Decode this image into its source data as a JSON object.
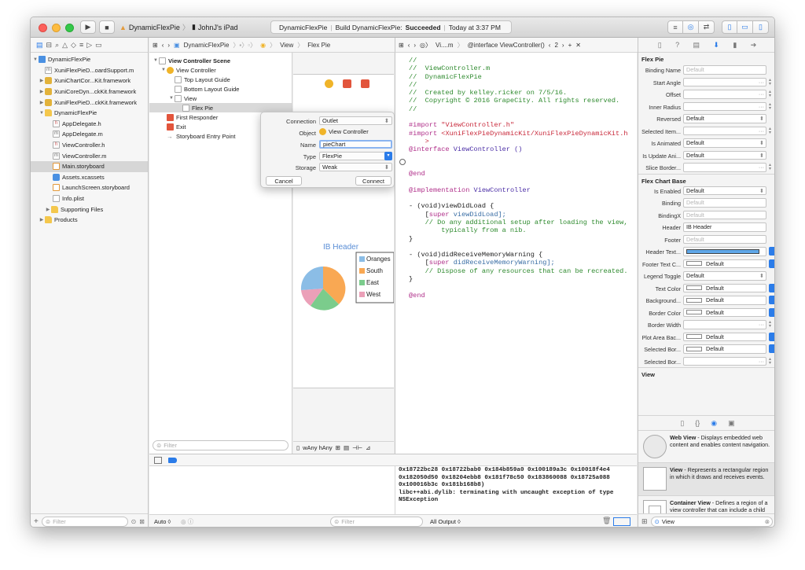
{
  "toolbar": {
    "scheme": "DynamicFlexPie",
    "device": "JohnJ's iPad",
    "activity_project": "DynamicFlexPie",
    "activity_build_prefix": "Build DynamicFlexPie:",
    "activity_build_status": "Succeeded",
    "activity_time": "Today at 3:37 PM"
  },
  "navigator": {
    "items": [
      {
        "label": "DynamicFlexPie"
      },
      {
        "label": "XuniFlexPieD...oardSupport.m"
      },
      {
        "label": "XuniChartCor...Kit.framework"
      },
      {
        "label": "XuniCoreDyn...ckKit.framework"
      },
      {
        "label": "XuniFlexPieD...ckKit.framework"
      },
      {
        "label": "DynamicFlexPie"
      },
      {
        "label": "AppDelegate.h"
      },
      {
        "label": "AppDelegate.m"
      },
      {
        "label": "ViewController.h"
      },
      {
        "label": "ViewController.m"
      },
      {
        "label": "Main.storyboard"
      },
      {
        "label": "Assets.xcassets"
      },
      {
        "label": "LaunchScreen.storyboard"
      },
      {
        "label": "Info.plist"
      },
      {
        "label": "Supporting Files"
      },
      {
        "label": "Products"
      }
    ],
    "filter_placeholder": "Filter"
  },
  "jumpbar": {
    "ib_path": [
      "DynamicFlexPie",
      "View",
      "Flex Pie"
    ],
    "editor_file": "Vi....m",
    "editor_symbol": "@interface ViewController()",
    "counter": "2"
  },
  "outline": {
    "items": [
      {
        "label": "View Controller Scene"
      },
      {
        "label": "View Controller"
      },
      {
        "label": "Top Layout Guide"
      },
      {
        "label": "Bottom Layout Guide"
      },
      {
        "label": "View"
      },
      {
        "label": "Flex Pie"
      },
      {
        "label": "First Responder"
      },
      {
        "label": "Exit"
      },
      {
        "label": "Storyboard Entry Point"
      }
    ],
    "filter_placeholder": "Filter"
  },
  "canvas": {
    "header": "IB Header",
    "legend": [
      "Oranges",
      "South",
      "East",
      "West"
    ],
    "size_class": "wAny hAny"
  },
  "popover": {
    "connection_label": "Connection",
    "connection_value": "Outlet",
    "object_label": "Object",
    "object_value": "View Controller",
    "name_label": "Name",
    "name_value": "pieChart",
    "type_label": "Type",
    "type_value": "FlexPie",
    "storage_label": "Storage",
    "storage_value": "Weak",
    "cancel": "Cancel",
    "connect": "Connect"
  },
  "code": {
    "l1": "//",
    "l2": "//  ViewController.m",
    "l3": "//  DynamicFlexPie",
    "l4": "//",
    "l5": "//  Created by kelley.ricker on 7/5/16.",
    "l6": "//  Copyright © 2016 GrapeCity. All rights reserved.",
    "l7": "//",
    "i1_kw": "#import",
    "i1_str": "\"ViewController.h\"",
    "i2_kw": "#import",
    "i2_str": "<XuniFlexPieDynamicKit/XuniFlexPieDynamicKit.h",
    "i2_cont": ">",
    "intf_kw": "@interface",
    "intf_name": "ViewController ()",
    "end1": "@end",
    "impl_kw": "@implementation",
    "impl_name": "ViewController",
    "m1_sig": "- (void)viewDidLoad {",
    "m1_super": "super",
    "m1_call": "viewDidLoad];",
    "m1_comment1": "// Do any additional setup after loading the view,",
    "m1_comment2": "typically from a nib.",
    "m1_close": "}",
    "m2_sig": "- (void)didReceiveMemoryWarning {",
    "m2_super": "super",
    "m2_call": "didReceiveMemoryWarning];",
    "m2_comment": "// Dispose of any resources that can be recreated.",
    "m2_close": "}",
    "end2": "@end"
  },
  "inspector": {
    "flexpie_title": "Flex Pie",
    "flexpie_rows": [
      {
        "label": "Binding Name",
        "value": "Default",
        "placeholder": true
      },
      {
        "label": "Start Angle",
        "value": "",
        "placeholder": false
      },
      {
        "label": "Offset",
        "value": "",
        "placeholder": false
      },
      {
        "label": "Inner Radius",
        "value": "",
        "placeholder": false
      },
      {
        "label": "Reversed",
        "value": "Default",
        "placeholder": false
      },
      {
        "label": "Selected Item...",
        "value": "",
        "placeholder": false
      },
      {
        "label": "Is Animated",
        "value": "Default",
        "placeholder": false
      },
      {
        "label": "Is Update Ani...",
        "value": "Default",
        "placeholder": false
      },
      {
        "label": "Slice Border...",
        "value": "",
        "placeholder": false
      }
    ],
    "flexchart_title": "Flex Chart Base",
    "flexchart_rows": [
      {
        "label": "Is Enabled",
        "value": "Default"
      },
      {
        "label": "Binding",
        "value": "Default"
      },
      {
        "label": "BindingX",
        "value": "Default"
      },
      {
        "label": "Header",
        "value": "IB Header"
      },
      {
        "label": "Footer",
        "value": "Default"
      },
      {
        "label": "Header Text...",
        "value": ""
      },
      {
        "label": "Footer Text C...",
        "value": "Default"
      },
      {
        "label": "Legend Toggle",
        "value": "Default"
      },
      {
        "label": "Text Color",
        "value": "Default"
      },
      {
        "label": "Background...",
        "value": "Default"
      },
      {
        "label": "Border Color",
        "value": "Default"
      },
      {
        "label": "Border Width",
        "value": ""
      },
      {
        "label": "Plot Area Bac...",
        "value": "Default"
      },
      {
        "label": "Selected Bor...",
        "value": "Default"
      },
      {
        "label": "Selected Bor...",
        "value": ""
      }
    ],
    "view_title": "View",
    "library": [
      {
        "title": "Web View",
        "desc": "- Displays embedded web content and enables content navigation."
      },
      {
        "title": "View",
        "desc": "- Represents a rectangular region in which it draws and receives events."
      },
      {
        "title": "Container View",
        "desc": "- Defines a region of a view controller that can include a child view controller."
      }
    ],
    "search_value": "View"
  },
  "debug": {
    "console_lines": [
      "0x18722bc28 0x18722bab0 0x184b859a0 0x100189a3c 0x10018f4e4",
      "0x182050d50 0x18204ebb8 0x181f78c50 0x183860088 0x18725a088",
      "0x100016b3c 0x181b168b8)",
      "libc++abi.dylib: terminating with uncaught exception of type",
      "NSException"
    ],
    "auto_label": "Auto ◊",
    "output_label": "All Output ◊",
    "filter_placeholder": "Filter"
  },
  "colors": {
    "accent": "#2b7ce9",
    "pie_oranges": "#8bbde6",
    "pie_south": "#f9a853",
    "pie_east": "#7bcc8c",
    "pie_west": "#eba0b8"
  }
}
